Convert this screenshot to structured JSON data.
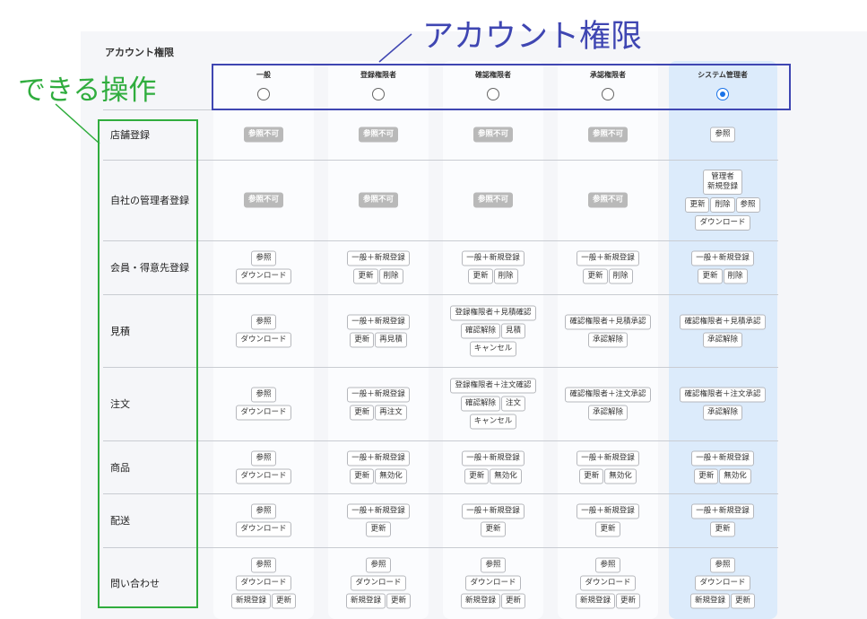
{
  "panel_title": "アカウント権限",
  "annotations": {
    "roles_callout": "アカウント権限",
    "operations_callout": "できる操作",
    "roles_color": "#3f46b2",
    "operations_color": "#30ad3e"
  },
  "selected_role_index": 4,
  "roles": [
    {
      "name": "一般"
    },
    {
      "name": "登録権限者"
    },
    {
      "name": "確認権限者"
    },
    {
      "name": "承認権限者"
    },
    {
      "name": "システム管理者"
    }
  ],
  "rows": [
    {
      "label": "店舗登録",
      "cells": [
        [
          [
            "参照不可"
          ]
        ],
        [
          [
            "参照不可"
          ]
        ],
        [
          [
            "参照不可"
          ]
        ],
        [
          [
            "参照不可"
          ]
        ],
        [
          [
            "参照"
          ]
        ]
      ]
    },
    {
      "label": "自社の管理者登録",
      "cells": [
        [
          [
            "参照不可"
          ]
        ],
        [
          [
            "参照不可"
          ]
        ],
        [
          [
            "参照不可"
          ]
        ],
        [
          [
            "参照不可"
          ]
        ],
        [
          [
            "管理者\n新規登録"
          ],
          [
            "更新",
            "削除",
            "参照"
          ],
          [
            "ダウンロード"
          ]
        ]
      ]
    },
    {
      "label": "会員・得意先登録",
      "cells": [
        [
          [
            "参照"
          ],
          [
            "ダウンロード"
          ]
        ],
        [
          [
            "一般＋新規登録"
          ],
          [
            "更新",
            "削除"
          ]
        ],
        [
          [
            "一般＋新規登録"
          ],
          [
            "更新",
            "削除"
          ]
        ],
        [
          [
            "一般＋新規登録"
          ],
          [
            "更新",
            "削除"
          ]
        ],
        [
          [
            "一般＋新規登録"
          ],
          [
            "更新",
            "削除"
          ]
        ]
      ]
    },
    {
      "label": "見積",
      "cells": [
        [
          [
            "参照"
          ],
          [
            "ダウンロード"
          ]
        ],
        [
          [
            "一般＋新規登録"
          ],
          [
            "更新",
            "再見積"
          ]
        ],
        [
          [
            "登録権限者＋見積確認"
          ],
          [
            "確認解除",
            "見積"
          ],
          [
            "キャンセル"
          ]
        ],
        [
          [
            "確認権限者＋見積承認"
          ],
          [
            "承認解除"
          ]
        ],
        [
          [
            "確認権限者＋見積承認"
          ],
          [
            "承認解除"
          ]
        ]
      ]
    },
    {
      "label": "注文",
      "cells": [
        [
          [
            "参照"
          ],
          [
            "ダウンロード"
          ]
        ],
        [
          [
            "一般＋新規登録"
          ],
          [
            "更新",
            "再注文"
          ]
        ],
        [
          [
            "登録権限者＋注文確認"
          ],
          [
            "確認解除",
            "注文"
          ],
          [
            "キャンセル"
          ]
        ],
        [
          [
            "確認権限者＋注文承認"
          ],
          [
            "承認解除"
          ]
        ],
        [
          [
            "確認権限者＋注文承認"
          ],
          [
            "承認解除"
          ]
        ]
      ]
    },
    {
      "label": "商品",
      "cells": [
        [
          [
            "参照"
          ],
          [
            "ダウンロード"
          ]
        ],
        [
          [
            "一般＋新規登録"
          ],
          [
            "更新",
            "無効化"
          ]
        ],
        [
          [
            "一般＋新規登録"
          ],
          [
            "更新",
            "無効化"
          ]
        ],
        [
          [
            "一般＋新規登録"
          ],
          [
            "更新",
            "無効化"
          ]
        ],
        [
          [
            "一般＋新規登録"
          ],
          [
            "更新",
            "無効化"
          ]
        ]
      ]
    },
    {
      "label": "配送",
      "cells": [
        [
          [
            "参照"
          ],
          [
            "ダウンロード"
          ]
        ],
        [
          [
            "一般＋新規登録"
          ],
          [
            "更新"
          ]
        ],
        [
          [
            "一般＋新規登録"
          ],
          [
            "更新"
          ]
        ],
        [
          [
            "一般＋新規登録"
          ],
          [
            "更新"
          ]
        ],
        [
          [
            "一般＋新規登録"
          ],
          [
            "更新"
          ]
        ]
      ]
    },
    {
      "label": "問い合わせ",
      "cells": [
        [
          [
            "参照"
          ],
          [
            "ダウンロード"
          ],
          [
            "新規登録",
            "更新"
          ]
        ],
        [
          [
            "参照"
          ],
          [
            "ダウンロード"
          ],
          [
            "新規登録",
            "更新"
          ]
        ],
        [
          [
            "参照"
          ],
          [
            "ダウンロード"
          ],
          [
            "新規登録",
            "更新"
          ]
        ],
        [
          [
            "参照"
          ],
          [
            "ダウンロード"
          ],
          [
            "新規登録",
            "更新"
          ]
        ],
        [
          [
            "参照"
          ],
          [
            "ダウンロード"
          ],
          [
            "新規登録",
            "更新"
          ]
        ]
      ]
    }
  ]
}
